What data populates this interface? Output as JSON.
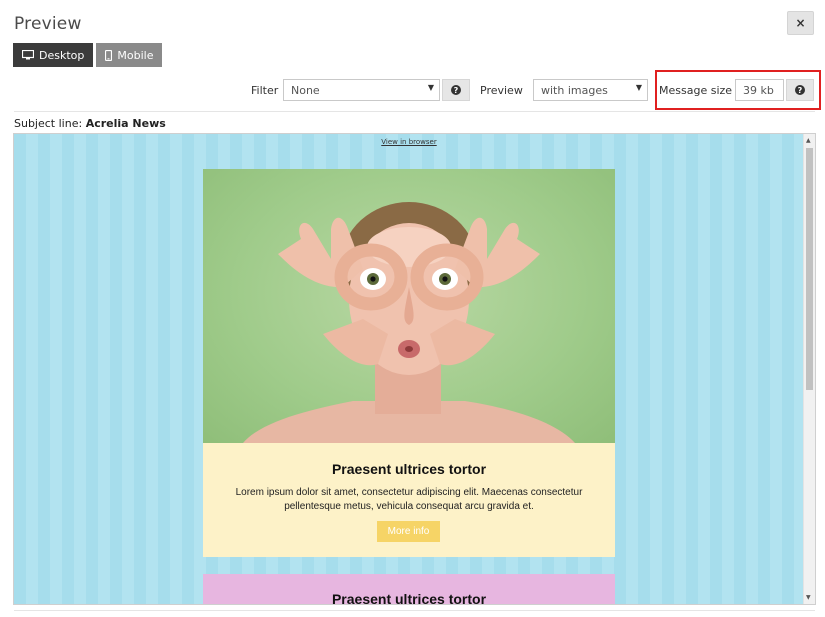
{
  "dialog": {
    "title": "Preview",
    "close_label": "×"
  },
  "tabs": [
    {
      "label": "Desktop",
      "icon": "desktop-icon",
      "active": true
    },
    {
      "label": "Mobile",
      "icon": "mobile-icon",
      "active": false
    }
  ],
  "toolbar": {
    "filter_label": "Filter",
    "filter_value": "None",
    "preview_label": "Preview",
    "preview_value": "with images",
    "message_size_label": "Message size",
    "message_size_value": "39 kb",
    "help_label": "?"
  },
  "subject": {
    "label": "Subject line:",
    "value": "Acrelia News"
  },
  "email": {
    "view_in_browser": "View in browser",
    "hero_image": "woman-making-glasses-with-hands",
    "block1": {
      "title": "Praesent ultrices tortor",
      "text": "Lorem ipsum dolor sit amet, consectetur adipiscing elit. Maecenas consectetur pellentesque metus, vehicula consequat arcu gravida et.",
      "button": "More info"
    },
    "block2": {
      "title": "Praesent ultrices tortor"
    }
  },
  "colors": {
    "email_background": "#a6ddec",
    "block1_background": "#fdf2c8",
    "button": "#f6d466",
    "block2_background": "#e7b6e0",
    "highlight": "#e02020"
  }
}
